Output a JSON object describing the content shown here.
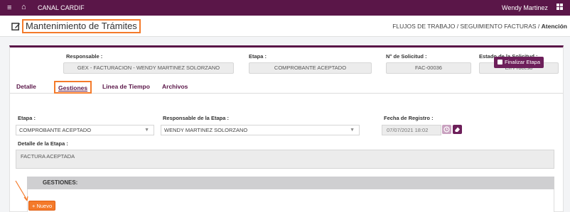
{
  "topbar": {
    "menu_icon": "hamburger-icon",
    "home_icon": "home-icon",
    "app_name": "CANAL CARDIF",
    "user_name": "Wendy Martinez",
    "apps_icon": "grid-icon"
  },
  "title": {
    "icon": "edit-icon",
    "text": "Mantenimiento de Trámites",
    "breadcrumb_path": "FLUJOS DE TRABAJO / SEGUIMIENTO FACTURAS / ",
    "breadcrumb_current": "Atención"
  },
  "header": {
    "responsable_label": "Responsable :",
    "responsable_value": "GEX - FACTURACION - WENDY MARTINEZ SOLORZANO",
    "etapa_label": "Etapa :",
    "etapa_value": "COMPROBANTE ACEPTADO",
    "solicitud_label": "N° de Solicitud :",
    "solicitud_value": "FAC-00036",
    "estado_label": "Estado de la Solicitud :",
    "estado_value": "En Proceso"
  },
  "tabs": [
    "Detalle",
    "Gestiones",
    "Linea de Tiempo",
    "Archivos"
  ],
  "active_tab": "Gestiones",
  "form": {
    "finalizar_label": "Finalizar Etapa",
    "etapa_label": "Etapa :",
    "etapa_value": "COMPROBANTE ACEPTADO",
    "responsable_label": "Responsable de la Etapa :",
    "responsable_value": "WENDY MARTINEZ SOLORZANO",
    "fecha_label": "Fecha de Registro :",
    "fecha_value": "07/07/2021 18:02",
    "detalle_label": "Detalle de la Etapa :",
    "detalle_value": "FACTURA ACEPTADA"
  },
  "gestiones": {
    "header": "GESTIONES:",
    "nuevo_label": "Nuevo"
  },
  "colors": {
    "brand": "#5a1648",
    "highlight": "#f47a2a",
    "clock_button": "#c9a2c0",
    "eraser_button": "#6d1f5a"
  }
}
